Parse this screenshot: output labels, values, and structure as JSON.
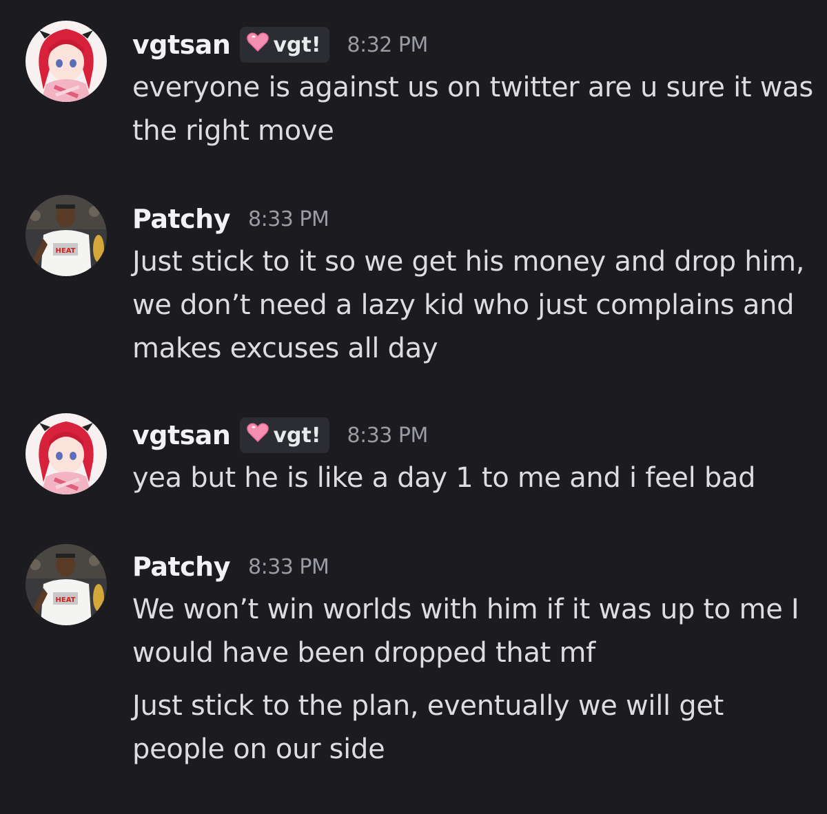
{
  "colors": {
    "background": "#1b1b20",
    "username": "#f2f3f5",
    "message_text": "#dcdde1",
    "timestamp": "#9a9ca4",
    "tag_background": "#2c2d33",
    "tag_heart": "#f48fb1"
  },
  "messages": [
    {
      "username": "vgtsan",
      "tag": "vgt!",
      "tag_icon": "pink-heart-icon",
      "avatar": "anime-girl-avatar",
      "time": "8:32 PM",
      "lines": [
        "everyone is against us on twitter are u sure it was the right move"
      ]
    },
    {
      "username": "Patchy",
      "avatar": "basketball-player-avatar",
      "time": "8:33 PM",
      "lines": [
        "Just stick to it so we get his money and drop him, we don’t need a lazy kid who just complains and makes excuses all day"
      ]
    },
    {
      "username": "vgtsan",
      "tag": "vgt!",
      "tag_icon": "pink-heart-icon",
      "avatar": "anime-girl-avatar",
      "time": "8:33 PM",
      "lines": [
        "yea but he is like a day 1 to me and i feel bad"
      ]
    },
    {
      "username": "Patchy",
      "avatar": "basketball-player-avatar",
      "time": "8:33 PM",
      "lines": [
        "We won’t win worlds with him if it was up to me I would have been dropped that mf",
        "Just stick to the plan, eventually we will get people on our side"
      ]
    }
  ]
}
